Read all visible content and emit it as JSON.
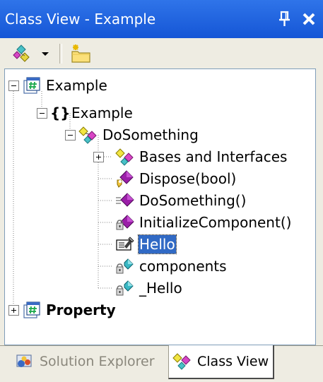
{
  "window": {
    "title": "Class View - Example",
    "accent": "#1a5fd8"
  },
  "toolbar": {
    "sort_icon": "sort-by-type-icon",
    "dropdown_icon": "chevron-down-icon",
    "new_folder_icon": "new-folder-icon"
  },
  "tree": {
    "nodes": [
      {
        "label": "Example",
        "icon": "project-icon",
        "expander": "minus"
      },
      {
        "label": "Example",
        "icon": "namespace-icon",
        "expander": "minus"
      },
      {
        "label": "DoSomething",
        "icon": "class-icon",
        "expander": "minus"
      },
      {
        "label": "Bases and Interfaces",
        "icon": "bases-interfaces-icon",
        "expander": "plus"
      },
      {
        "label": "Dispose(bool)",
        "icon": "protected-method-icon"
      },
      {
        "label": "DoSomething()",
        "icon": "public-method-icon"
      },
      {
        "label": "InitializeComponent()",
        "icon": "private-method-icon"
      },
      {
        "label": "Hello",
        "icon": "property-icon",
        "selected": true
      },
      {
        "label": "components",
        "icon": "private-field-icon"
      },
      {
        "label": "_Hello",
        "icon": "private-field-icon"
      },
      {
        "label": "Property",
        "icon": "project-icon",
        "expander": "plus",
        "bold": true
      }
    ]
  },
  "tabs": [
    {
      "label": "Solution Explorer",
      "icon": "solution-explorer-icon",
      "active": false
    },
    {
      "label": "Class View",
      "icon": "class-view-icon",
      "active": true
    }
  ]
}
